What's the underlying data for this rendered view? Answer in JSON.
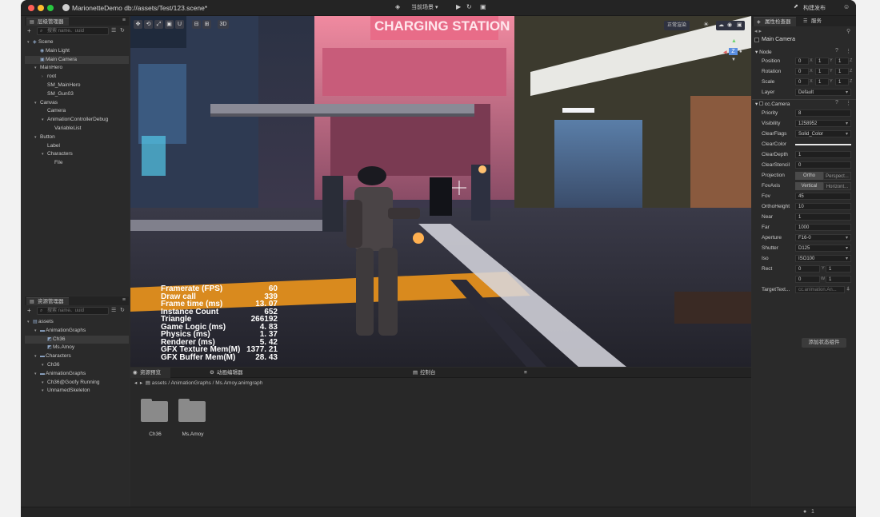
{
  "titlebar": {
    "title": "MarionetteDemo db://assets/Test/123.scene*",
    "scene_select": "当前场景",
    "publish_label": "构建发布"
  },
  "hierarchy": {
    "tab_label": "层级管理器",
    "search_placeholder": "搜索 name、uuid",
    "items": [
      {
        "label": "Scene",
        "depth": 0,
        "twisty": "▾",
        "icon": "◈",
        "selected": false
      },
      {
        "label": "Main Light",
        "depth": 1,
        "twisty": "",
        "icon": "◉",
        "selected": false
      },
      {
        "label": "Main Camera",
        "depth": 1,
        "twisty": "",
        "icon": "▣",
        "selected": true
      },
      {
        "label": "MainHero",
        "depth": 1,
        "twisty": "▾",
        "icon": "",
        "selected": false
      },
      {
        "label": "root",
        "depth": 2,
        "twisty": "›",
        "icon": "",
        "selected": false
      },
      {
        "label": "SM_MainHero",
        "depth": 2,
        "twisty": "",
        "icon": "",
        "selected": false
      },
      {
        "label": "SM_Gun03",
        "depth": 2,
        "twisty": "",
        "icon": "",
        "selected": false
      },
      {
        "label": "Canvas",
        "depth": 1,
        "twisty": "▾",
        "icon": "",
        "selected": false
      },
      {
        "label": "Camera",
        "depth": 2,
        "twisty": "",
        "icon": "",
        "selected": false
      },
      {
        "label": "AnimationControllerDebug",
        "depth": 2,
        "twisty": "▾",
        "icon": "",
        "selected": false
      },
      {
        "label": "VariableList",
        "depth": 3,
        "twisty": "",
        "icon": "",
        "selected": false
      },
      {
        "label": "Button",
        "depth": 1,
        "twisty": "▾",
        "icon": "",
        "selected": false
      },
      {
        "label": "Label",
        "depth": 2,
        "twisty": "",
        "icon": "",
        "selected": false
      },
      {
        "label": "Characters",
        "depth": 2,
        "twisty": "▾",
        "icon": "",
        "selected": false
      },
      {
        "label": "File",
        "depth": 3,
        "twisty": "",
        "icon": "",
        "selected": false
      }
    ]
  },
  "assets": {
    "tab_label": "资源管理器",
    "search_placeholder": "搜索 name、uuid",
    "items": [
      {
        "label": "assets",
        "depth": 0,
        "twisty": "▾",
        "icon": "▤",
        "selected": false
      },
      {
        "label": "AnimationGraphs",
        "depth": 1,
        "twisty": "▾",
        "icon": "▬",
        "selected": false
      },
      {
        "label": "Ch36",
        "depth": 2,
        "twisty": "",
        "icon": "◩",
        "selected": true
      },
      {
        "label": "Ms.Amoy",
        "depth": 2,
        "twisty": "",
        "icon": "◩",
        "selected": false
      },
      {
        "label": "Characters",
        "depth": 1,
        "twisty": "▾",
        "icon": "▬",
        "selected": false
      },
      {
        "label": "Ch36",
        "depth": 2,
        "twisty": "▾",
        "icon": "",
        "selected": false
      },
      {
        "label": "AnimationGraphs",
        "depth": 1,
        "twisty": "▾",
        "icon": "▬",
        "selected": false
      },
      {
        "label": "Ch36@Goofy Running",
        "depth": 2,
        "twisty": "▾",
        "icon": "",
        "selected": false
      },
      {
        "label": "UnnamedSkeleton",
        "depth": 2,
        "twisty": "▾",
        "icon": "",
        "selected": false
      }
    ]
  },
  "viewport": {
    "mode_label": "正常渲染",
    "gizmo_label": "Z",
    "tool_labels": [
      "✥",
      "⟲",
      "⤢",
      "▣",
      "U",
      "⊟",
      "⊞",
      "3D"
    ],
    "stats": [
      {
        "label": "Framerate (FPS)",
        "value": "60"
      },
      {
        "label": "Draw call",
        "value": "339"
      },
      {
        "label": "Frame time (ms)",
        "value": "13. 07"
      },
      {
        "label": "Instance Count",
        "value": "652"
      },
      {
        "label": "Triangle",
        "value": "266192"
      },
      {
        "label": "Game Logic (ms)",
        "value": "4. 83"
      },
      {
        "label": "Physics (ms)",
        "value": "1. 37"
      },
      {
        "label": "Renderer (ms)",
        "value": "5. 42"
      },
      {
        "label": "GFX Texture Mem(M)",
        "value": "1377. 21"
      },
      {
        "label": "GFX Buffer Mem(M)",
        "value": "28. 43"
      }
    ],
    "scene_sign": "CHARGING STATION"
  },
  "bottom": {
    "tabs": [
      "资源预览",
      "动画编辑器",
      "控制台"
    ],
    "breadcrumb": "assets / AnimationGraphs / Ms.Amoy.animgraph",
    "folders": [
      "Ch36",
      "Ms.Amoy"
    ]
  },
  "inspector": {
    "tabs": [
      "属性检查器",
      "服务"
    ],
    "node_name": "Main Camera",
    "node_section": "Node",
    "transform": [
      {
        "label": "Position",
        "x": "0",
        "y": "1",
        "z": "1"
      },
      {
        "label": "Rotation",
        "x": "0",
        "y": "1",
        "z": "1"
      },
      {
        "label": "Scale",
        "x": "0",
        "y": "1",
        "z": "1"
      }
    ],
    "layer_label": "Layer",
    "layer_value": "Default",
    "camera_section": "cc.Camera",
    "props": [
      {
        "label": "Priority",
        "value": "8",
        "kind": "field"
      },
      {
        "label": "Visibility",
        "value": "1258952",
        "kind": "dropdown"
      },
      {
        "label": "ClearFlags",
        "value": "Solid_Color",
        "kind": "dropdown"
      },
      {
        "label": "ClearColor",
        "value": "",
        "kind": "color"
      },
      {
        "label": "ClearDepth",
        "value": "1",
        "kind": "field"
      },
      {
        "label": "ClearStencil",
        "value": "0",
        "kind": "field"
      },
      {
        "label": "Projection",
        "value": "",
        "kind": "seg",
        "options": [
          "Ortho",
          "Perspect..."
        ],
        "active": 0
      },
      {
        "label": "FovAxis",
        "value": "",
        "kind": "seg",
        "options": [
          "Vertical",
          "Horizont..."
        ],
        "active": 0
      },
      {
        "label": "Fov",
        "value": "45",
        "kind": "field"
      },
      {
        "label": "OrthoHeight",
        "value": "10",
        "kind": "field"
      },
      {
        "label": "Near",
        "value": "1",
        "kind": "field"
      },
      {
        "label": "Far",
        "value": "1000",
        "kind": "field"
      },
      {
        "label": "Aperture",
        "value": "F16-0",
        "kind": "dropdown"
      },
      {
        "label": "Shutter",
        "value": "D125",
        "kind": "dropdown"
      },
      {
        "label": "Iso",
        "value": "ISO100",
        "kind": "dropdown"
      }
    ],
    "rect_label": "Rect",
    "rect": {
      "x": "0",
      "y": "1",
      "w": "0",
      "h": "1"
    },
    "target_label": "TargetText...",
    "target_value": "cc.animation.An...",
    "add_component": "添加状态组件"
  },
  "status": {
    "count": "1"
  }
}
